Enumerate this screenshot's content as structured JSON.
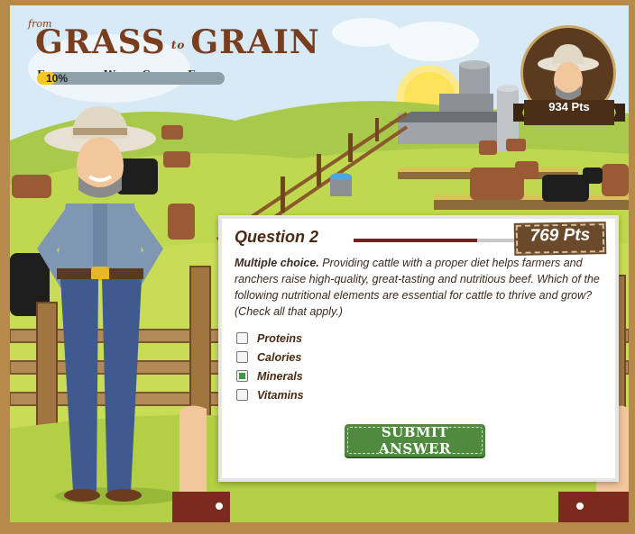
{
  "game": {
    "logo": {
      "from": "from",
      "title_left": "GRASS",
      "title_to": "to",
      "title_right": "GRAIN",
      "subtitle": "Exploring What Cattle Eat"
    },
    "progress": {
      "label": "10%",
      "value": 0.1
    },
    "player": {
      "points": "934 Pts"
    }
  },
  "question": {
    "title": "Question 2",
    "timer_fraction": 0.76,
    "points": "769 Pts",
    "type_label": "Multiple choice.",
    "prompt": " Providing cattle with a proper diet helps farmers and ranchers raise high-quality, great-tasting and nutritious beef. Which of the following nutritional elements are essential for cattle to thrive and grow? (Check all that apply.)",
    "options": [
      {
        "label": "Proteins",
        "checked": false
      },
      {
        "label": "Calories",
        "checked": false
      },
      {
        "label": "Minerals",
        "checked": true
      },
      {
        "label": "Vitamins",
        "checked": false
      }
    ],
    "submit_label": "SUBMIT ANSWER"
  },
  "colors": {
    "accent_brown": "#7a3e1e",
    "submit_green": "#4f8a3f",
    "progress_yellow": "#f4c81d",
    "timer_red": "#7d1e1e"
  }
}
